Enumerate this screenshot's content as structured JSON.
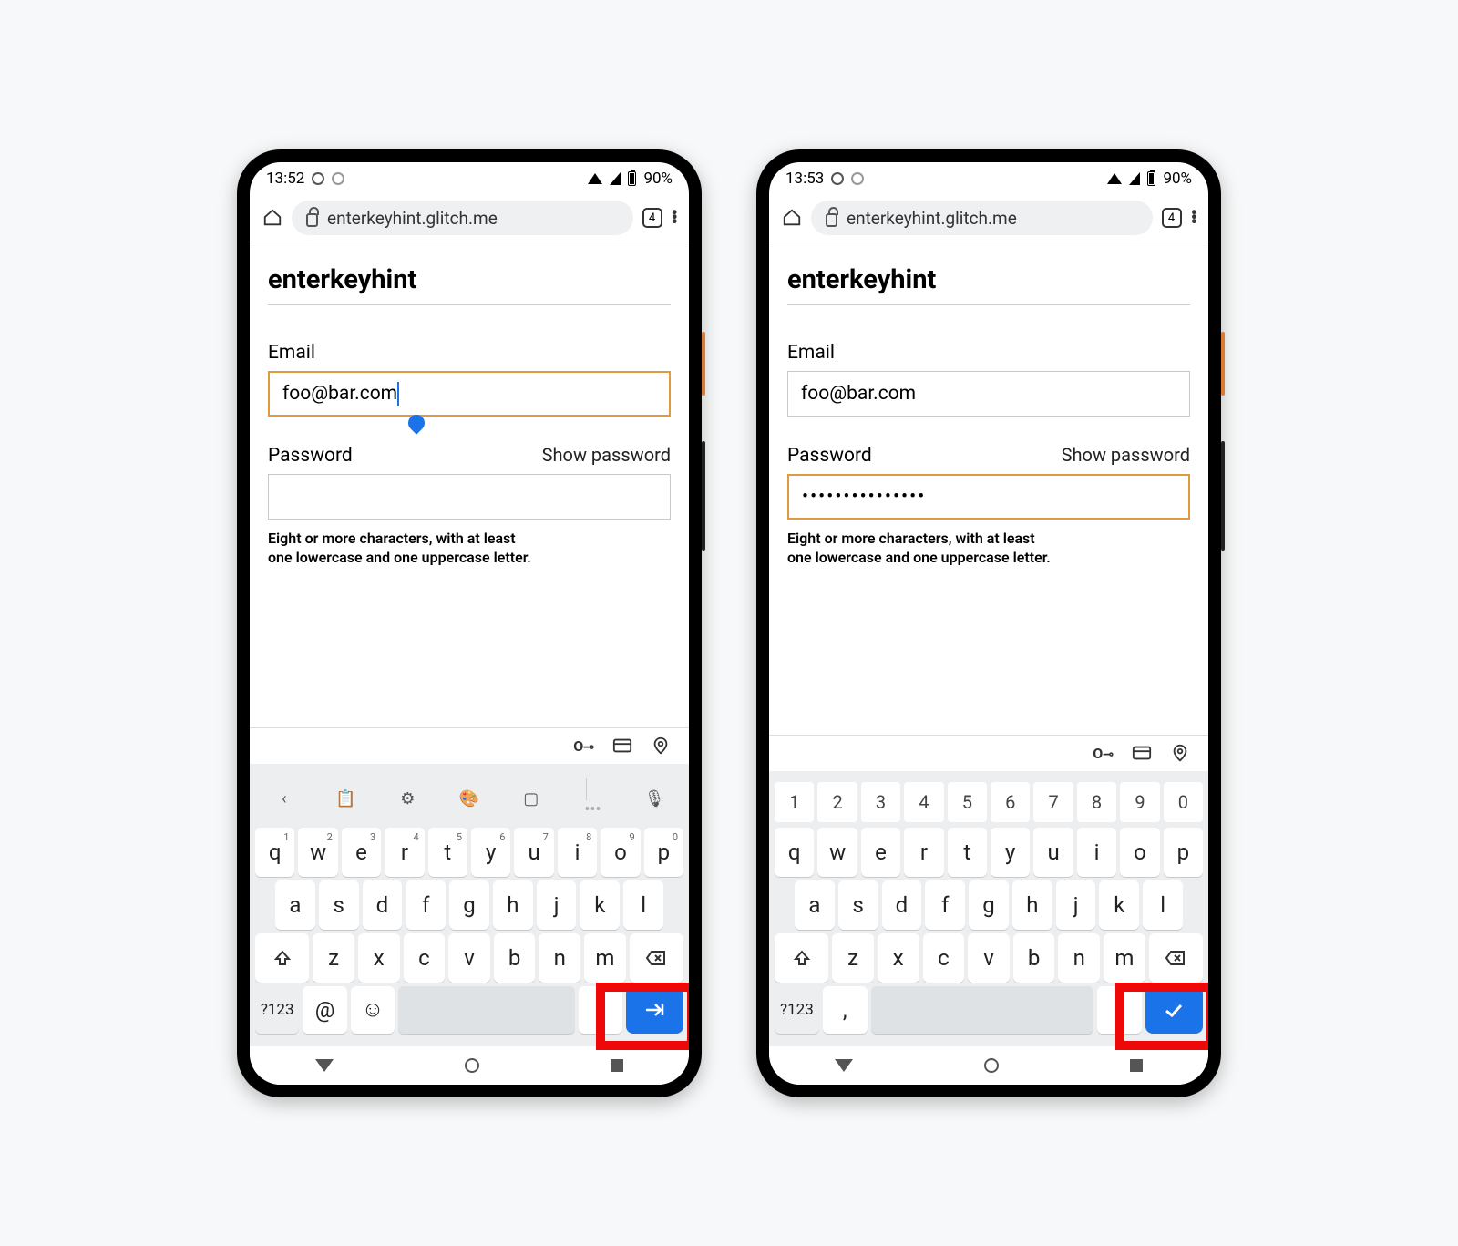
{
  "phones": [
    {
      "status": {
        "time": "13:52",
        "battery": "90%"
      },
      "url": "enterkeyhint.glitch.me",
      "tab_count": "4",
      "page_title": "enterkeyhint",
      "email": {
        "label": "Email",
        "value": "foo@bar.com",
        "focused": true,
        "caret": true
      },
      "password": {
        "label": "Password",
        "show_label": "Show password",
        "value": "",
        "focused": false
      },
      "hint": "Eight or more characters, with at least\none lowercase and one uppercase letter.",
      "keyboard": {
        "variant": "email",
        "toolbar": [
          "back",
          "clipboard",
          "gear",
          "palette",
          "sticker",
          "divider",
          "more",
          "mic"
        ],
        "row1": [
          [
            "q",
            "1"
          ],
          [
            "w",
            "2"
          ],
          [
            "e",
            "3"
          ],
          [
            "r",
            "4"
          ],
          [
            "t",
            "5"
          ],
          [
            "y",
            "6"
          ],
          [
            "u",
            "7"
          ],
          [
            "i",
            "8"
          ],
          [
            "o",
            "9"
          ],
          [
            "p",
            "0"
          ]
        ],
        "row2": [
          "a",
          "s",
          "d",
          "f",
          "g",
          "h",
          "j",
          "k",
          "l"
        ],
        "row3": [
          "shift",
          "z",
          "x",
          "c",
          "v",
          "b",
          "n",
          "m",
          "bksp"
        ],
        "row4": {
          "mode": "?123",
          "left1": "@",
          "left2": "emoji",
          "punct": ".",
          "enter_icon": "next"
        }
      }
    },
    {
      "status": {
        "time": "13:53",
        "battery": "90%"
      },
      "url": "enterkeyhint.glitch.me",
      "tab_count": "4",
      "page_title": "enterkeyhint",
      "email": {
        "label": "Email",
        "value": "foo@bar.com",
        "focused": false,
        "caret": false
      },
      "password": {
        "label": "Password",
        "show_label": "Show password",
        "value": "•••••••••••••••",
        "focused": true
      },
      "hint": "Eight or more characters, with at least\none lowercase and one uppercase letter.",
      "keyboard": {
        "variant": "password",
        "nums": [
          "1",
          "2",
          "3",
          "4",
          "5",
          "6",
          "7",
          "8",
          "9",
          "0"
        ],
        "row1": [
          [
            "q",
            ""
          ],
          [
            "w",
            ""
          ],
          [
            "e",
            ""
          ],
          [
            "r",
            ""
          ],
          [
            "t",
            ""
          ],
          [
            "y",
            ""
          ],
          [
            "u",
            ""
          ],
          [
            "i",
            ""
          ],
          [
            "o",
            ""
          ],
          [
            "p",
            ""
          ]
        ],
        "row2": [
          "a",
          "s",
          "d",
          "f",
          "g",
          "h",
          "j",
          "k",
          "l"
        ],
        "row3": [
          "shift",
          "z",
          "x",
          "c",
          "v",
          "b",
          "n",
          "m",
          "bksp"
        ],
        "row4": {
          "mode": "?123",
          "left1": ",",
          "left2": "",
          "punct": ".",
          "enter_icon": "done"
        }
      }
    }
  ]
}
